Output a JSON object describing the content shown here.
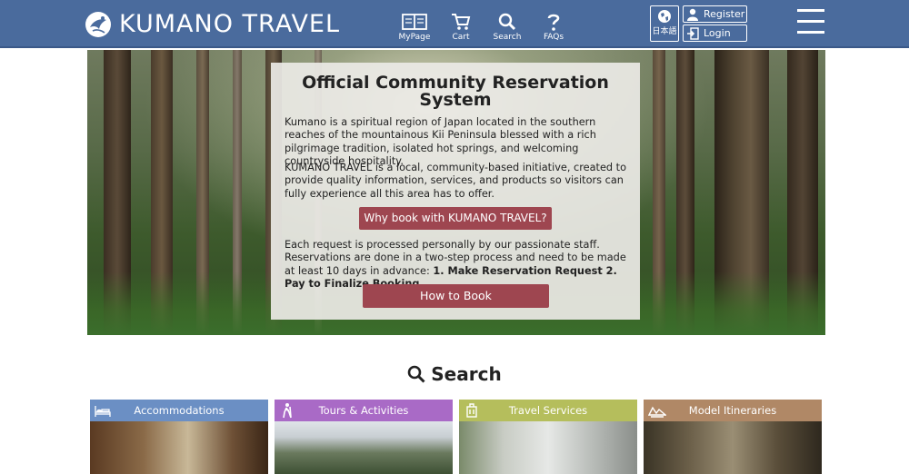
{
  "header": {
    "logo_text": "KUMANO TRAVEL",
    "nav": [
      {
        "label": "MyPage",
        "icon": "book-icon"
      },
      {
        "label": "Cart",
        "icon": "cart-icon"
      },
      {
        "label": "Search",
        "icon": "search-icon"
      },
      {
        "label": "FAQs",
        "icon": "question-icon"
      }
    ],
    "language_label": "日本語",
    "register_label": "Register",
    "login_label": "Login"
  },
  "hero": {
    "title": "Official Community Reservation System",
    "intro": "Kumano is a spiritual region of Japan located in the southern reaches of the mountainous Kii Peninsula blessed with a rich pilgrimage tradition, isolated hot springs, and welcoming countryside hospitality.",
    "initiative": "KUMANO TRAVEL is a local, community-based initiative, created to provide quality information, services, and products so visitors can fully experience all this area has to offer.",
    "why_button": "Why book with KUMANO TRAVEL?",
    "process_text": "Each request is processed personally by our passionate staff. Reservations are done in a two-step process and need to be made at least 10 days in advance: ",
    "step_text": "1. Make Reservation Request 2. Pay to Finalize Booking",
    "period": ".",
    "how_button": "How to Book"
  },
  "search": {
    "title": "Search",
    "categories": [
      {
        "label": "Accommodations",
        "color": "#6b8fc4",
        "icon": "bed-icon"
      },
      {
        "label": "Tours & Activities",
        "color": "#a96ac6",
        "icon": "hiker-icon"
      },
      {
        "label": "Travel Services",
        "color": "#b5be5c",
        "icon": "luggage-icon"
      },
      {
        "label": "Model Itineraries",
        "color": "#b08866",
        "icon": "map-icon"
      }
    ]
  }
}
